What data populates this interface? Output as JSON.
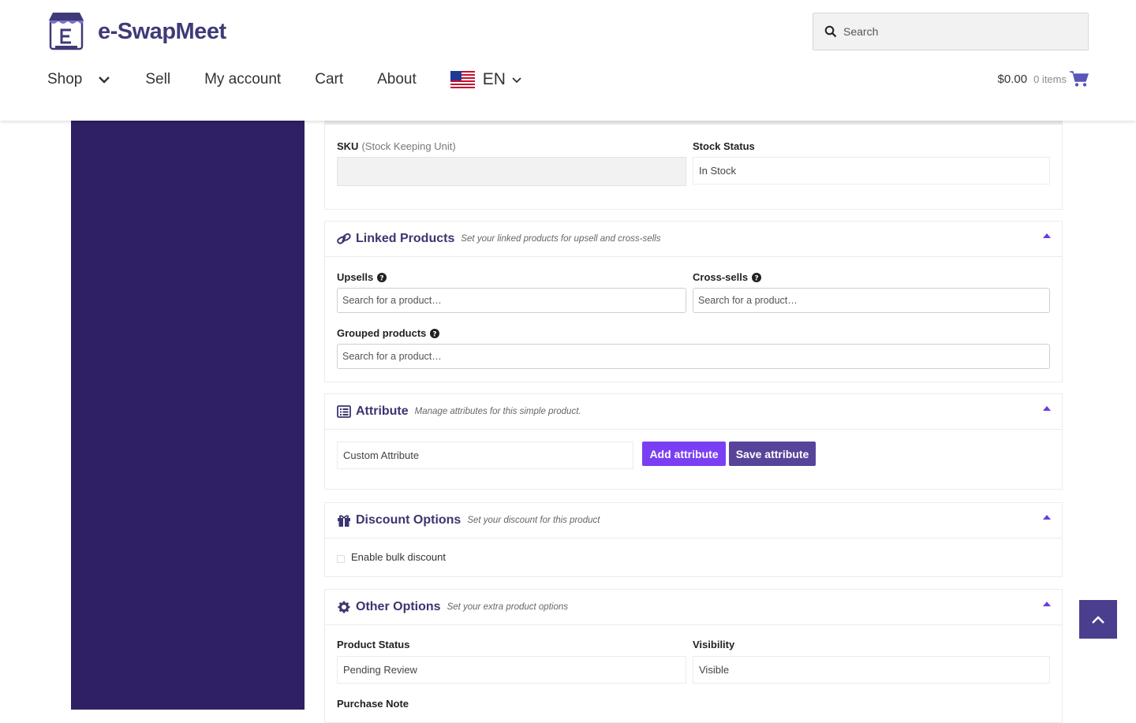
{
  "brand": {
    "name": "e-SwapMeet"
  },
  "search": {
    "placeholder": "Search"
  },
  "nav": {
    "shop": "Shop",
    "sell": "Sell",
    "my_account": "My account",
    "cart": "Cart",
    "about": "About",
    "language": "EN"
  },
  "cart": {
    "amount": "$0.00",
    "items": "0 items"
  },
  "inventory": {
    "sku_label": "SKU",
    "sku_hint": "(Stock Keeping Unit)",
    "sku_value": "",
    "stock_status_label": "Stock Status",
    "stock_status_value": "In Stock"
  },
  "linked_products": {
    "title": "Linked Products",
    "subtitle": "Set your linked products for upsell and cross-sells",
    "upsells_label": "Upsells",
    "cross_sells_label": "Cross-sells",
    "grouped_label": "Grouped products",
    "search_placeholder": "Search for a product…"
  },
  "attribute": {
    "title": "Attribute",
    "subtitle": "Manage attributes for this simple product.",
    "select_value": "Custom Attribute",
    "add_button": "Add attribute",
    "save_button": "Save attribute"
  },
  "discount": {
    "title": "Discount Options",
    "subtitle": "Set your discount for this product",
    "bulk_label": "Enable bulk discount"
  },
  "other_options": {
    "title": "Other Options",
    "subtitle": "Set your extra product options",
    "status_label": "Product Status",
    "status_value": "Pending Review",
    "visibility_label": "Visibility",
    "visibility_value": "Visible",
    "purchase_note_label": "Purchase Note"
  },
  "colors": {
    "brand": "#3f3a78",
    "sidebar": "#2f1f63",
    "accent": "#7a3ff2",
    "save": "#57449a",
    "back_to_top": "#4a3f8e"
  }
}
